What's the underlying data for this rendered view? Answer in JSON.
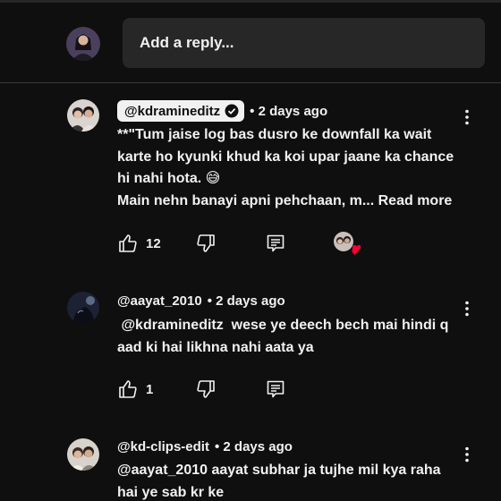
{
  "reply_bar": {
    "placeholder": "Add a reply..."
  },
  "comments": [
    {
      "author": "@kdramineditz",
      "time": "• 2 days ago",
      "line1": "**\"Tum jaise log bas dusro ke downfall ka wait karte ho kyunki khud ka koi upar jaane ka chance hi nahi hota. 😅",
      "line2": "Main nehn banayi apni pehchaan, m...",
      "read_more": "Read more",
      "likes": "12"
    },
    {
      "author": "@aayat_2010",
      "time": "• 2 days ago",
      "text": " @kdramineditz  wese ye deech bech mai hindi q aad ki hai likhna nahi aata ya",
      "likes": "1"
    },
    {
      "author": "@kd-clips-edit",
      "time": "• 2 days ago",
      "text": "@aayat_2010 aayat subhar ja tujhe mil kya raha hai ye sab kr ke"
    }
  ],
  "icons": {
    "like": "thumb-up-icon",
    "dislike": "thumb-down-icon",
    "reply": "reply-icon",
    "more": "more-vert-icon",
    "verified": "verified-check-icon"
  },
  "colors": {
    "background": "#0f0f0f",
    "surface": "#272727",
    "text": "#f1f1f1",
    "heart": "#ff0033"
  }
}
